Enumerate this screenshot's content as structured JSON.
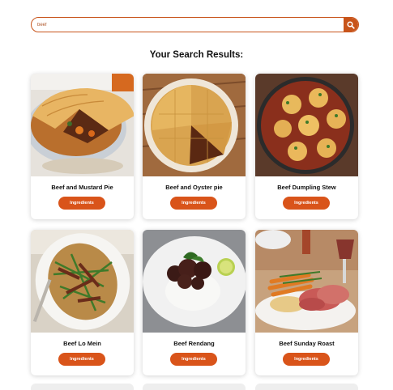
{
  "search": {
    "value": "beef"
  },
  "results_title": "Your Search Results:",
  "recipes": [
    {
      "name": "Beef and Mustard Pie",
      "button": "Ingredients"
    },
    {
      "name": "Beef and Oyster pie",
      "button": "Ingredients"
    },
    {
      "name": "Beef Dumpling Stew",
      "button": "Ingredients"
    },
    {
      "name": "Beef Lo Mein",
      "button": "Ingredients"
    },
    {
      "name": "Beef Rendang",
      "button": "Ingredients"
    },
    {
      "name": "Beef Sunday Roast",
      "button": "Ingredients"
    }
  ],
  "colors": {
    "accent": "#d9541a",
    "border": "#c8541a"
  },
  "icons": {
    "search": "search-icon"
  }
}
